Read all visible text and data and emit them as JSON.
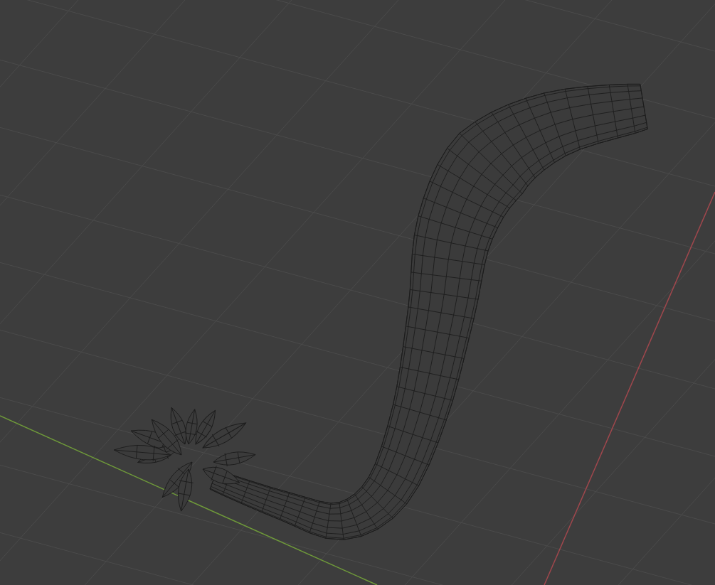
{
  "viewport": {
    "axes": [
      {
        "kind": "x",
        "color": "#a0474d"
      },
      {
        "kind": "y",
        "color": "#6f9a3a"
      }
    ]
  }
}
